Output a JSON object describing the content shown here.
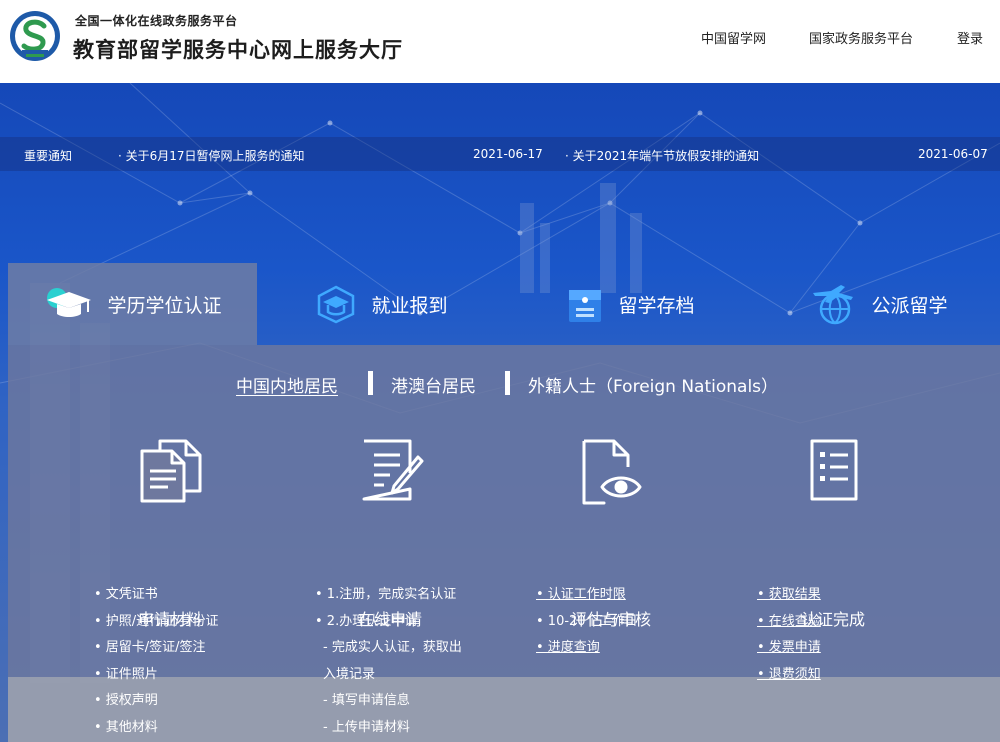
{
  "header": {
    "subtitle": "全国一体化在线政务服务平台",
    "title": "教育部留学服务中心网上服务大厅",
    "nav": [
      "中国留学网",
      "国家政务服务平台",
      "登录"
    ]
  },
  "notices": {
    "label": "重要通知",
    "items": [
      {
        "text": "· 关于6月17日暂停网上服务的通知",
        "date": "2021-06-17"
      },
      {
        "text": "· 关于2021年端午节放假安排的通知",
        "date": "2021-06-07"
      }
    ]
  },
  "tabs": [
    "学历学位认证",
    "就业报到",
    "留学存档",
    "公派留学"
  ],
  "subtabs": [
    "中国内地居民",
    "港澳台居民",
    "外籍人士（Foreign Nationals）"
  ],
  "steps": [
    "申请材料",
    "在线申请",
    "评估与审核",
    "认证完成"
  ],
  "columns": {
    "materials": [
      "• 文凭证书",
      "• 护照/通行证/身份证",
      "• 居留卡/签证/签注",
      "• 证件照片",
      "• 授权声明",
      "• 其他材料"
    ],
    "apply": [
      "• 1.注册，完成实名认证",
      "• 2.办理认证申请",
      "- 完成实人认证，获取出",
      "入境记录",
      "- 填写申请信息",
      "- 上传申请材料"
    ],
    "review": [
      "• 认证工作时限",
      "• 10-20个工作日",
      "• 进度查询"
    ],
    "done": [
      "• 获取结果",
      "• 在线查验",
      "• 发票申请",
      "• 退费须知"
    ]
  },
  "colors": {
    "accent": "#1a56c9",
    "logo_blue": "#1e5aa8",
    "logo_green": "#2f9a4f"
  }
}
